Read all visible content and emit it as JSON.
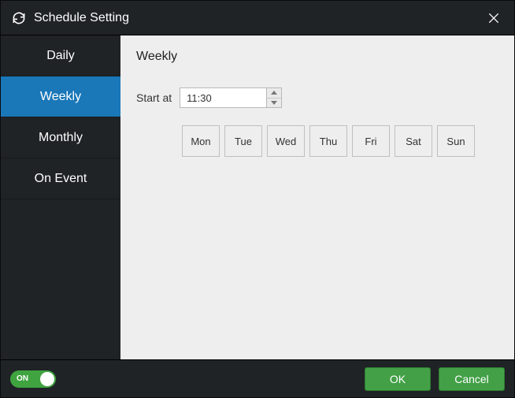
{
  "title": "Schedule Setting",
  "sidebar": {
    "tabs": [
      {
        "label": "Daily"
      },
      {
        "label": "Weekly"
      },
      {
        "label": "Monthly"
      },
      {
        "label": "On Event"
      }
    ],
    "active_index": 1
  },
  "main": {
    "heading": "Weekly",
    "start_label": "Start at",
    "start_value": "11:30",
    "days": [
      "Mon",
      "Tue",
      "Wed",
      "Thu",
      "Fri",
      "Sat",
      "Sun"
    ]
  },
  "footer": {
    "toggle_state": "ON",
    "ok_label": "OK",
    "cancel_label": "Cancel"
  }
}
